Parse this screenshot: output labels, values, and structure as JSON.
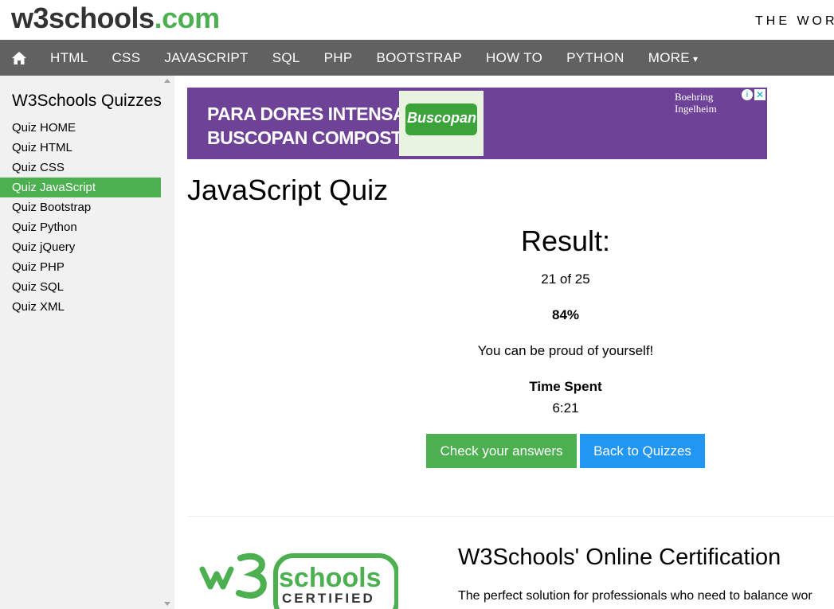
{
  "header": {
    "logo_main": "w3schools",
    "logo_suffix": ".com",
    "tagline": "THE WORL"
  },
  "nav": {
    "home_icon": "home-icon",
    "items": [
      "HTML",
      "CSS",
      "JAVASCRIPT",
      "SQL",
      "PHP",
      "BOOTSTRAP",
      "HOW TO",
      "PYTHON",
      "MORE"
    ],
    "more_caret": "▾"
  },
  "sidebar": {
    "title": "W3Schools Quizzes",
    "items": [
      "Quiz HOME",
      "Quiz HTML",
      "Quiz CSS",
      "Quiz JavaScript",
      "Quiz Bootstrap",
      "Quiz Python",
      "Quiz jQuery",
      "Quiz PHP",
      "Quiz SQL",
      "Quiz XML"
    ],
    "active_index": 3
  },
  "ad": {
    "headline_1": "PARA DORES INTENSAS,",
    "headline_2": "BUSCOPAN COMPOSTO.",
    "product": "Buscopan",
    "brand_1": "Boehring",
    "brand_2": "Ingelheim",
    "close_label": "✕",
    "info_label": "i"
  },
  "main": {
    "title": "JavaScript Quiz",
    "result": {
      "heading": "Result:",
      "score": "21 of 25",
      "percent": "84%",
      "message": "You can be proud of yourself!",
      "time_label": "Time Spent",
      "time_value": "6:21"
    },
    "buttons": {
      "check": "Check your answers",
      "back": "Back to Quizzes"
    }
  },
  "certification": {
    "logo_text_1": "schools",
    "logo_text_2": "CERTIFIED",
    "title": "W3Schools' Online Certification",
    "description": "The perfect solution for professionals who need to balance wor"
  },
  "colors": {
    "green": "#4CAF50",
    "blue": "#2196F3",
    "nav_bg": "#616161",
    "sidebar_bg": "#f1f1f1"
  }
}
